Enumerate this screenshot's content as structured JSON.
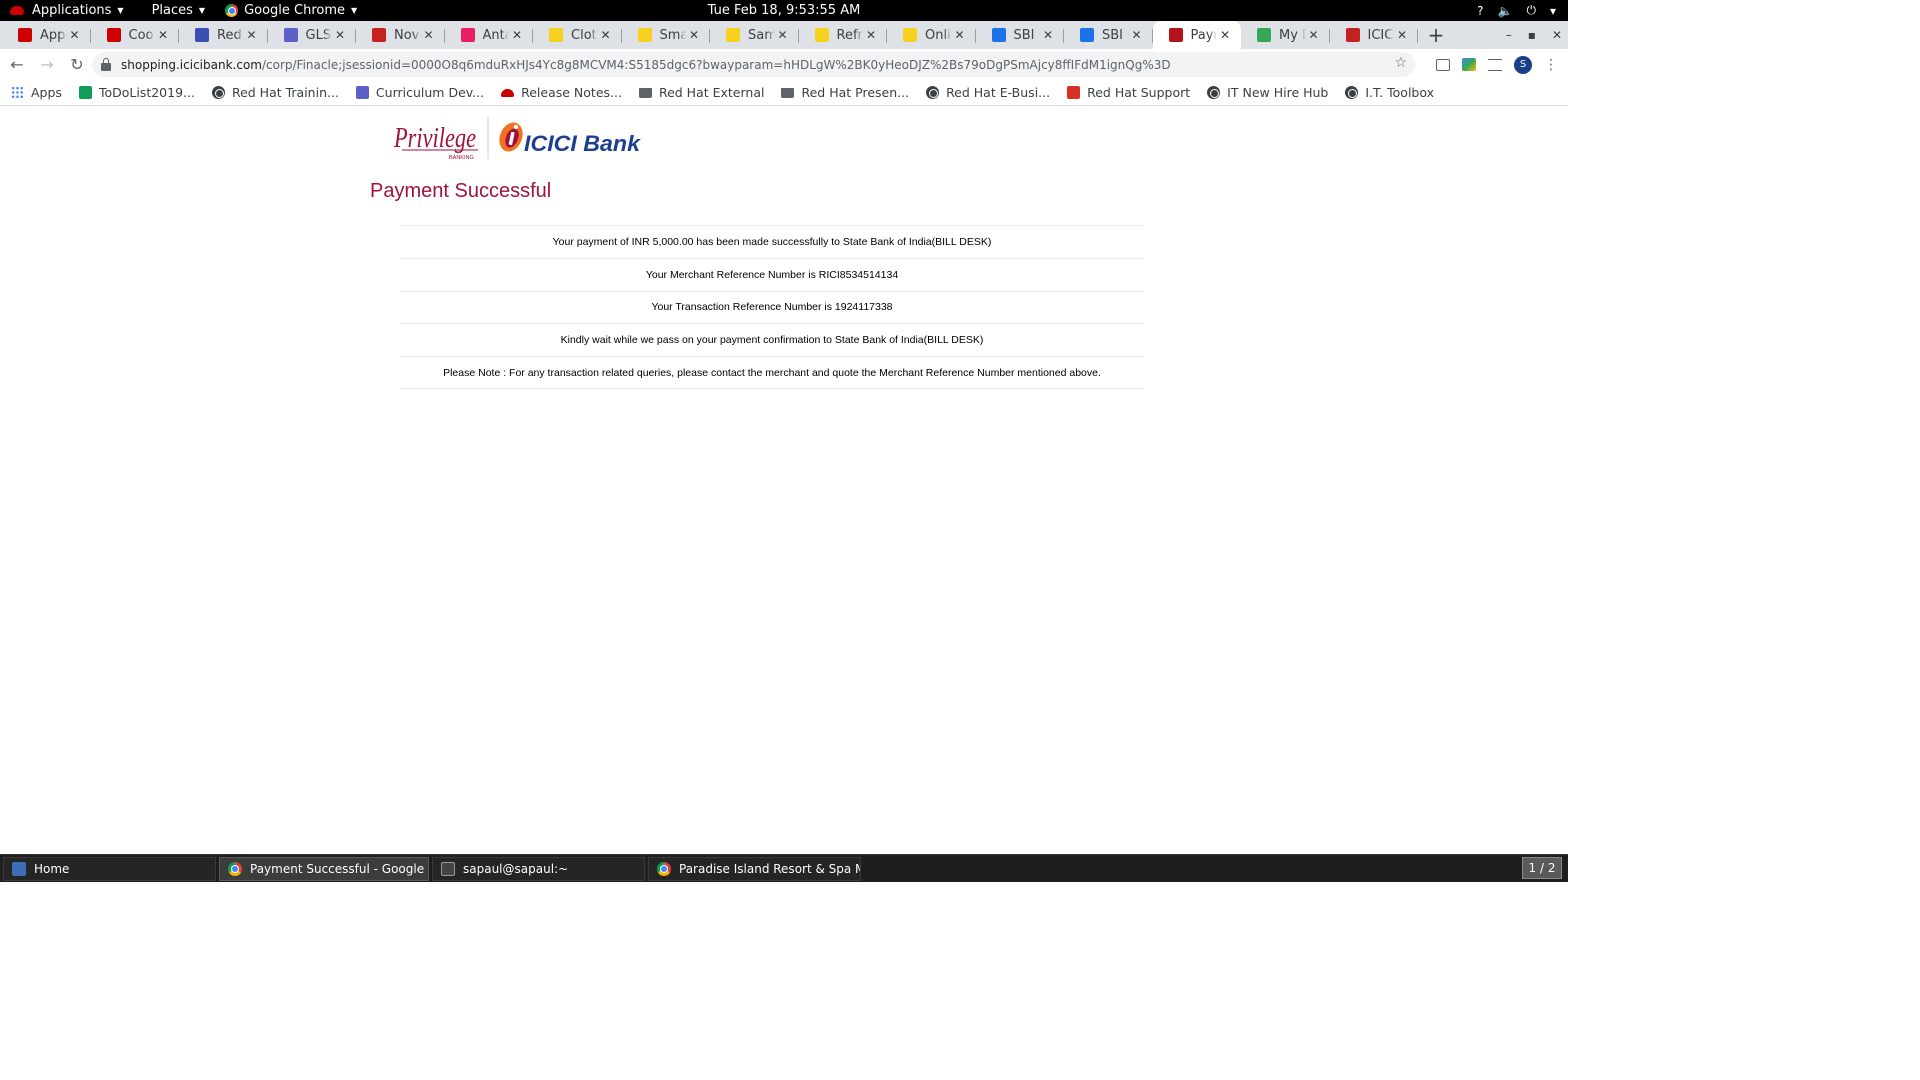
{
  "topbar": {
    "applications": "Applications",
    "places": "Places",
    "browser": "Google Chrome",
    "clock": "Tue Feb 18,  9:53:55 AM",
    "tray": {
      "help": "?",
      "volume": "🔈",
      "power": "⏻",
      "menu": "▾"
    }
  },
  "tabs": [
    {
      "title": "Apps - Red Hat",
      "favicon": "redhat-icon",
      "color": "#cc0000"
    },
    {
      "title": "Cool Stuff",
      "favicon": "redhat-icon",
      "color": "#cc0000"
    },
    {
      "title": "Red Hat Calendar",
      "favicon": "calendar-icon",
      "color": "#3c4fb0"
    },
    {
      "title": "GLS Wiki",
      "favicon": "docs-icon",
      "color": "#5b5fc7"
    },
    {
      "title": "Novell",
      "favicon": "gmail-icon",
      "color": "#c5221f"
    },
    {
      "title": "Antara",
      "favicon": "pin-icon",
      "color": "#e91e63"
    },
    {
      "title": "Clothes",
      "favicon": "flipkart-icon",
      "color": "#f7d11f"
    },
    {
      "title": "Smartwatch",
      "favicon": "flipkart-icon",
      "color": "#f7d11f"
    },
    {
      "title": "Samsung",
      "favicon": "flipkart-icon",
      "color": "#f7d11f"
    },
    {
      "title": "Refrigerator",
      "favicon": "flipkart-icon",
      "color": "#f7d11f"
    },
    {
      "title": "Online",
      "favicon": "flipkart-icon",
      "color": "#f7d11f"
    },
    {
      "title": "SBI Credit",
      "favicon": "sbi-icon",
      "color": "#1a73e8"
    },
    {
      "title": "SBI Card",
      "favicon": "sbi-icon",
      "color": "#1a73e8"
    },
    {
      "title": "Payment Successful",
      "favicon": "icici-icon",
      "color": "#b5121b",
      "active": true
    },
    {
      "title": "My Drive",
      "favicon": "drive-icon",
      "color": "#34a853"
    },
    {
      "title": "ICICI Bank",
      "favicon": "gmail-icon",
      "color": "#c5221f"
    }
  ],
  "new_tab": "+",
  "window_controls": {
    "minimize": "–",
    "maximize": "▪",
    "close": "✕"
  },
  "toolbar": {
    "back": "←",
    "forward": "→",
    "reload": "↻",
    "url_host": "shopping.icicibank.com",
    "url_path": "/corp/Finacle;jsessionid=0000O8q6mduRxHJs4Yc8g8MCVM4:S5185dgc6?bwayparam=hHDLgW%2BK0yHeoDJZ%2Bs79oDgPSmAjcy8ffIFdM1ignQg%3D",
    "star": "☆",
    "avatar": "S",
    "menu": "⋮"
  },
  "bookmarks": [
    {
      "label": "Apps",
      "icon": "grid"
    },
    {
      "label": "ToDoList2019...",
      "icon": "sheet"
    },
    {
      "label": "Red Hat Trainin...",
      "icon": "globe"
    },
    {
      "label": "Curriculum Dev...",
      "icon": "doc"
    },
    {
      "label": "Release Notes...",
      "icon": "hat"
    },
    {
      "label": "Red Hat External",
      "icon": "folder"
    },
    {
      "label": "Red Hat Presen...",
      "icon": "folder"
    },
    {
      "label": "Red Hat E-Busi...",
      "icon": "globe"
    },
    {
      "label": "Red Hat Support",
      "icon": "now"
    },
    {
      "label": "IT New Hire Hub",
      "icon": "globe"
    },
    {
      "label": "I.T. Toolbox",
      "icon": "globe"
    }
  ],
  "page": {
    "logo": {
      "privilege_text": "Privilege",
      "privilege_sub": "BANKING",
      "bank_text": "ICICI Bank",
      "brand_color": "#a0123c",
      "bank_color": "#1d3f8f",
      "orange": "#f37021"
    },
    "heading": "Payment Successful",
    "messages": [
      "Your payment of INR 5,000.00 has been made successfully to State Bank of India(BILL DESK)",
      "Your Merchant Reference Number is RICI8534514134",
      "Your Transaction Reference Number is 1924117338",
      "Kindly wait while we pass on your payment confirmation to State Bank of India(BILL DESK)",
      "Please Note : For any transaction related queries, please contact the merchant and quote the Merchant Reference Number mentioned above."
    ]
  },
  "taskbar": {
    "items": [
      {
        "label": "Home",
        "icon": "home"
      },
      {
        "label": "Payment Successful - Google Chr...",
        "icon": "chrome",
        "active": true
      },
      {
        "label": "sapaul@sapaul:~",
        "icon": "term"
      },
      {
        "label": "Paradise Island Resort & Spa Mald...",
        "icon": "chrome"
      }
    ],
    "workspace": "1 / 2"
  }
}
